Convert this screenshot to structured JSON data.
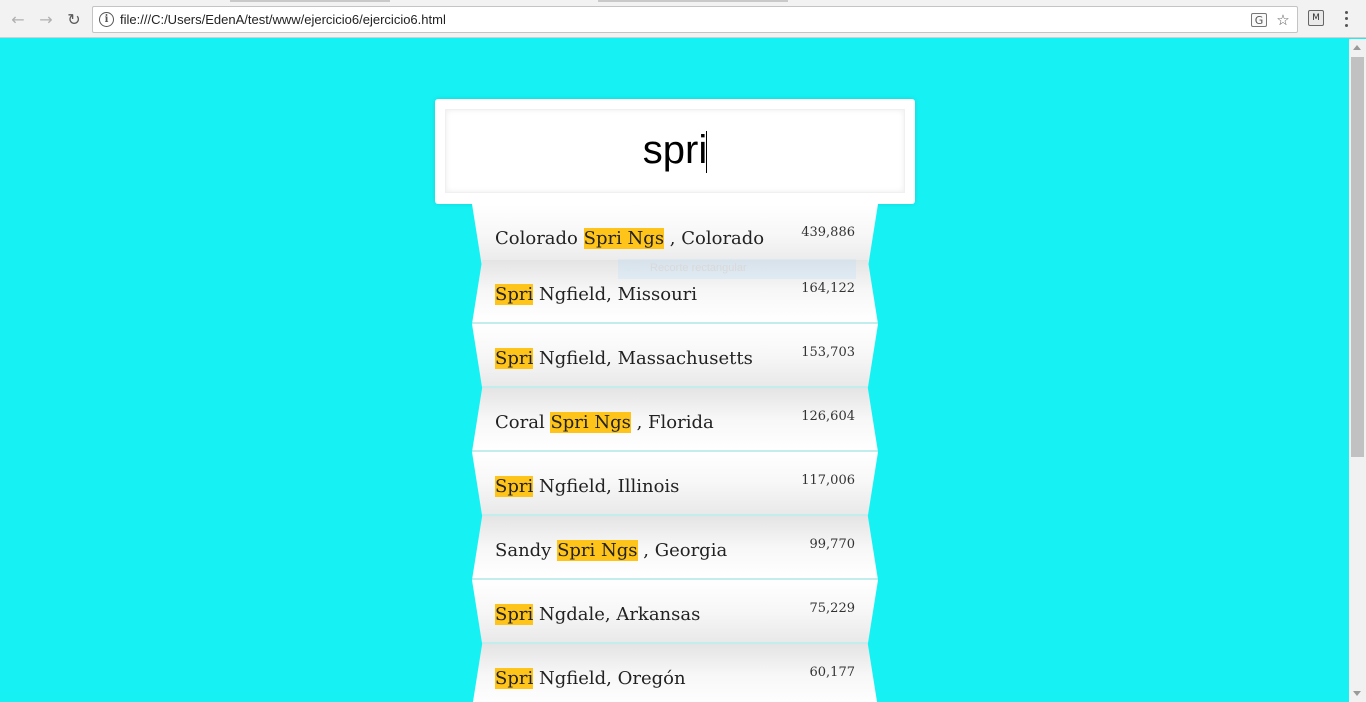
{
  "browser": {
    "url": "file:///C:/Users/EdenA/test/www/ejercicio6/ejercicio6.html",
    "back_icon": "←",
    "forward_icon": "→",
    "reload_icon": "↻",
    "info_icon": "i",
    "translate_icon": "G",
    "star_icon": "☆",
    "extension_icon": "M"
  },
  "search": {
    "value": "spri"
  },
  "suggestions": [
    {
      "pre": "Colorado ",
      "match": "Spri Ngs",
      "post": " , Colorado",
      "population": "439,886"
    },
    {
      "pre": "",
      "match": "Spri",
      "post": " Ngfield, Missouri",
      "population": "164,122"
    },
    {
      "pre": "",
      "match": "Spri",
      "post": " Ngfield, Massachusetts",
      "population": "153,703"
    },
    {
      "pre": "Coral ",
      "match": "Spri Ngs",
      "post": " , Florida",
      "population": "126,604"
    },
    {
      "pre": "",
      "match": "Spri",
      "post": " Ngfield, Illinois",
      "population": "117,006"
    },
    {
      "pre": "Sandy ",
      "match": "Spri Ngs",
      "post": " , Georgia",
      "population": "99,770"
    },
    {
      "pre": "",
      "match": "Spri",
      "post": " Ngdale, Arkansas",
      "population": "75,229"
    },
    {
      "pre": "",
      "match": "Spri",
      "post": " Ngfield, Oregón",
      "population": "60,177"
    }
  ],
  "overlay": {
    "label": "Recorte rectangular"
  },
  "colors": {
    "page_background": "#16f2f4",
    "highlight": "#ffc41a"
  }
}
